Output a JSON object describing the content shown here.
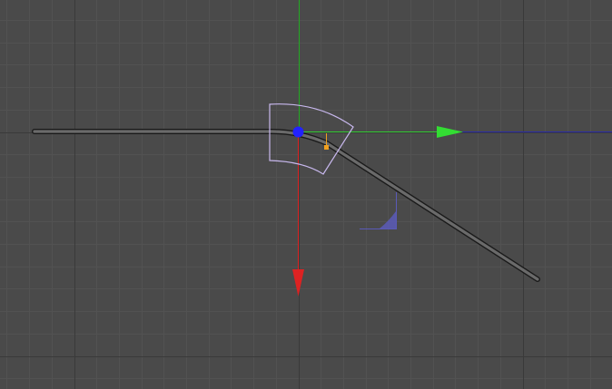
{
  "viewport": {
    "background_color": "#4a4a4a",
    "grid_minor_color": "#525252",
    "grid_major_color": "#3a3a3a"
  },
  "axes": {
    "x_color": "#33cc33",
    "y_color": "#dd2222",
    "z_color": "#2a2aa8",
    "vertical_guide_color": "#22aa22"
  },
  "spline": {
    "outer_color": "#1a1a1a",
    "inner_color": "#6a6a6a"
  },
  "gizmo": {
    "rotation_arc_color": "#c8b8ee",
    "pivot_color": "#2222ff",
    "handle_color": "#f0a020",
    "angle_indicator_color": "#5a5ab8"
  }
}
